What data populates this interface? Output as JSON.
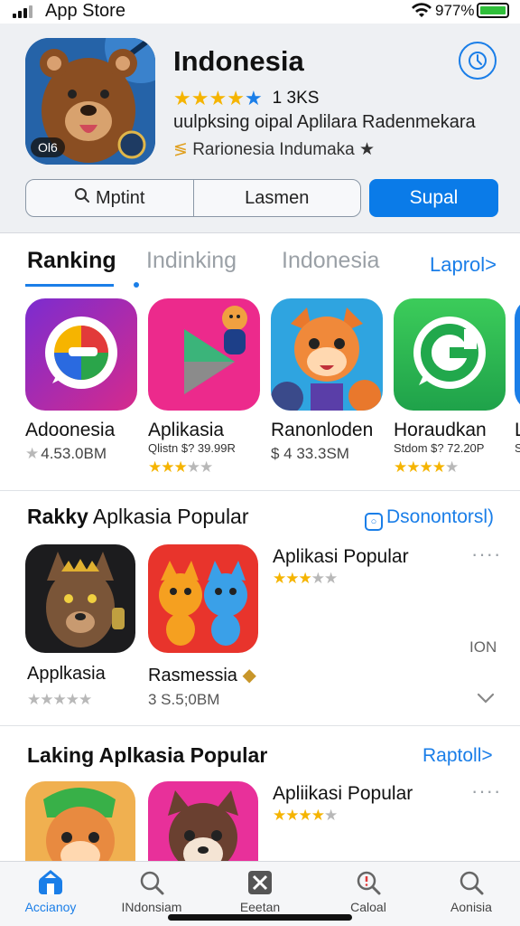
{
  "status_bar": {
    "carrier": "App Store",
    "battery": "977%"
  },
  "app": {
    "title": "Indonesia",
    "rating_count": "1 3KS",
    "description": "uulpksing oipal Aplilara Radenmekara",
    "developer": "Rarionesia Indumaka ★",
    "icon_badge": "Ol6",
    "segments": [
      "Mptint",
      "Lasmen"
    ],
    "get_label": "Supal"
  },
  "tabs": {
    "items": [
      "Ranking",
      "Indinking",
      "Indonesia"
    ],
    "link": "Laprol>"
  },
  "ranking": [
    {
      "name": "Adoonesia",
      "sub": "",
      "price": "4.53.0BM",
      "stars": 1
    },
    {
      "name": "Aplikasia",
      "sub": "Qlistn  $? 39.99R",
      "price": "",
      "stars": 3
    },
    {
      "name": "Ranonloden",
      "sub": "",
      "price": "$ 4 33.3SM",
      "stars": 0
    },
    {
      "name": "Horaudkan",
      "sub": "Stdom  $? 72.20P",
      "price": "",
      "stars": 4
    },
    {
      "name": "L",
      "sub": "S",
      "price": "",
      "stars": 0
    }
  ],
  "section1": {
    "title_bold": "Rakky",
    "title_rest": " Aplkasia Popular",
    "link": "Dsonontorsl)",
    "items": [
      {
        "name": "Applkasia",
        "meta": ""
      },
      {
        "name": "Rasmessia",
        "meta": "3 S.5;0BM"
      }
    ],
    "side_title": "Aplikasi Popular",
    "side_extra": "ION"
  },
  "section2": {
    "title_bold": "Laking Aplkasia Popular",
    "link": "Raptoll>",
    "side_title": "Apliikasi Popular"
  },
  "tabbar": [
    {
      "label": "Accianoy",
      "icon": "app-store-icon"
    },
    {
      "label": "INdonsiam",
      "icon": "search-icon"
    },
    {
      "label": "Eeetan",
      "icon": "close-box-icon"
    },
    {
      "label": "Caloal",
      "icon": "alert-search-icon"
    },
    {
      "label": "Aonisia",
      "icon": "search-icon"
    }
  ],
  "colors": {
    "accent": "#0a7be8",
    "star": "#f5b400"
  }
}
